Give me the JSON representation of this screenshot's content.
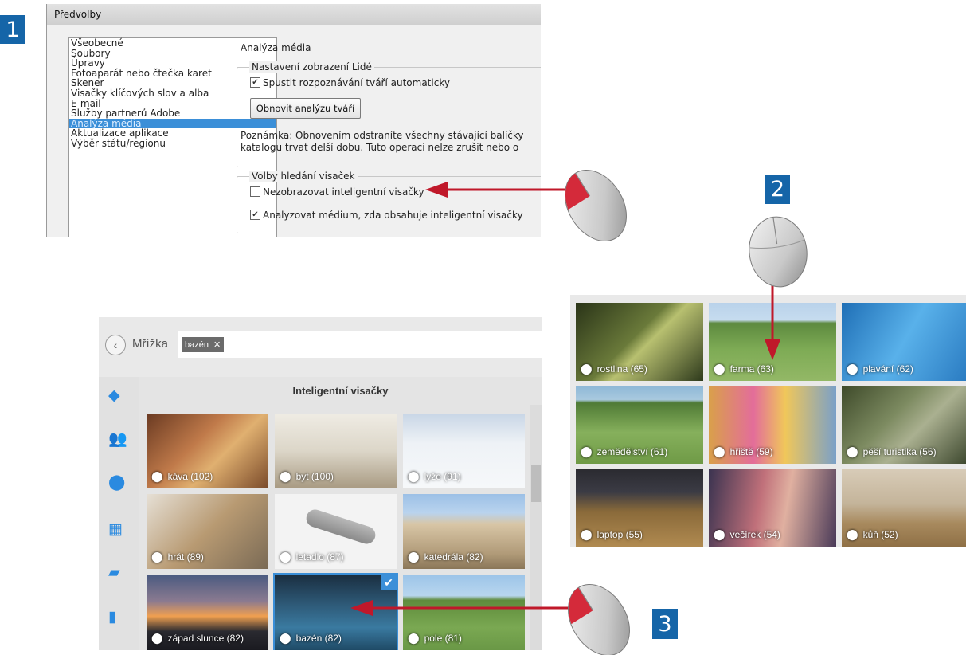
{
  "steps": [
    "1",
    "2",
    "3"
  ],
  "preferences": {
    "window_title": "Předvolby",
    "categories": [
      "Všeobecné",
      "Soubory",
      "Úpravy",
      "Fotoaparát nebo čtečka karet",
      "Skener",
      "Visačky klíčových slov a alba",
      "E-mail",
      "Služby partnerů Adobe",
      "Analýza média",
      "Aktualizace aplikace",
      "Výběr státu/regionu"
    ],
    "selected_category": "Analýza média",
    "section_title": "Analýza média",
    "people_group": {
      "title": "Nastavení zobrazení Lidé",
      "auto_face_label": "Spustit rozpoznávání tváří automaticky",
      "auto_face_checked": true,
      "refresh_button": "Obnovit analýzu tváří",
      "note_line1": "Poznámka: Obnovením odstraníte všechny stávající balíčky",
      "note_line2": "katalogu trvat delší dobu. Tuto operaci nelze zrušit nebo o"
    },
    "tag_group": {
      "title": "Volby hledání visaček",
      "hide_smart_label": "Nezobrazovat inteligentní visačky",
      "hide_smart_checked": false,
      "analyze_label": "Analyzovat médium, zda obsahuje inteligentní visačky",
      "analyze_checked": true
    }
  },
  "smart_tags_overview": [
    {
      "label": "rostlina (65)",
      "bg": "#4a5a2a"
    },
    {
      "label": "farma (63)",
      "bg": "#6f9a4a"
    },
    {
      "label": "plavání (62)",
      "bg": "#3d8fd0"
    },
    {
      "label": "zemědělství (61)",
      "bg": "#7aa24c"
    },
    {
      "label": "hřiště (59)",
      "bg": "#c08a3e"
    },
    {
      "label": "pěší turistika (56)",
      "bg": "#5f6d4a"
    },
    {
      "label": "laptop (55)",
      "bg": "#8a6a3a"
    },
    {
      "label": "večírek (54)",
      "bg": "#9a6a6a"
    },
    {
      "label": "kůň (52)",
      "bg": "#b29770"
    }
  ],
  "grid_view": {
    "back_label": "Mřížka",
    "search_tag": "bazén",
    "panel_title": "Inteligentní visačky",
    "tiles": [
      {
        "label": "káva (102)",
        "bg": "#a8734a"
      },
      {
        "label": "byt (100)",
        "bg": "#d8d2c4"
      },
      {
        "label": "lyže (91)",
        "bg": "#e8eef4"
      },
      {
        "label": "hrát (89)",
        "bg": "#c8b38e"
      },
      {
        "label": "letadlo (87)",
        "bg": "#f2f2f2"
      },
      {
        "label": "katedrála (82)",
        "bg": "#c8b59a"
      },
      {
        "label": "západ slunce (82)",
        "bg": "#3a3a4a"
      },
      {
        "label": "bazén (82)",
        "bg": "#234e6a"
      },
      {
        "label": "pole (81)",
        "bg": "#6f9c4a"
      }
    ],
    "selected_tile": "bazén (82)"
  },
  "colors": {
    "arrow": "#c0182a",
    "step_badge": "#1565a8",
    "accent_icon": "#2a8ae0",
    "selection": "#3b8fd8"
  }
}
